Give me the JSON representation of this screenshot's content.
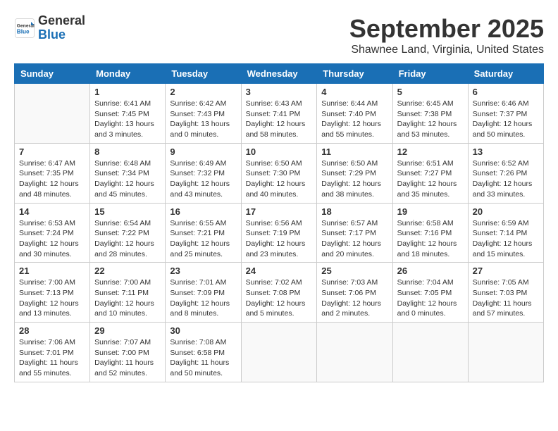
{
  "header": {
    "logo": {
      "general": "General",
      "blue": "Blue"
    },
    "title": "September 2025",
    "location": "Shawnee Land, Virginia, United States"
  },
  "days_of_week": [
    "Sunday",
    "Monday",
    "Tuesday",
    "Wednesday",
    "Thursday",
    "Friday",
    "Saturday"
  ],
  "weeks": [
    [
      {
        "day": "",
        "info": ""
      },
      {
        "day": "1",
        "info": "Sunrise: 6:41 AM\nSunset: 7:45 PM\nDaylight: 13 hours\nand 3 minutes."
      },
      {
        "day": "2",
        "info": "Sunrise: 6:42 AM\nSunset: 7:43 PM\nDaylight: 13 hours\nand 0 minutes."
      },
      {
        "day": "3",
        "info": "Sunrise: 6:43 AM\nSunset: 7:41 PM\nDaylight: 12 hours\nand 58 minutes."
      },
      {
        "day": "4",
        "info": "Sunrise: 6:44 AM\nSunset: 7:40 PM\nDaylight: 12 hours\nand 55 minutes."
      },
      {
        "day": "5",
        "info": "Sunrise: 6:45 AM\nSunset: 7:38 PM\nDaylight: 12 hours\nand 53 minutes."
      },
      {
        "day": "6",
        "info": "Sunrise: 6:46 AM\nSunset: 7:37 PM\nDaylight: 12 hours\nand 50 minutes."
      }
    ],
    [
      {
        "day": "7",
        "info": "Sunrise: 6:47 AM\nSunset: 7:35 PM\nDaylight: 12 hours\nand 48 minutes."
      },
      {
        "day": "8",
        "info": "Sunrise: 6:48 AM\nSunset: 7:34 PM\nDaylight: 12 hours\nand 45 minutes."
      },
      {
        "day": "9",
        "info": "Sunrise: 6:49 AM\nSunset: 7:32 PM\nDaylight: 12 hours\nand 43 minutes."
      },
      {
        "day": "10",
        "info": "Sunrise: 6:50 AM\nSunset: 7:30 PM\nDaylight: 12 hours\nand 40 minutes."
      },
      {
        "day": "11",
        "info": "Sunrise: 6:50 AM\nSunset: 7:29 PM\nDaylight: 12 hours\nand 38 minutes."
      },
      {
        "day": "12",
        "info": "Sunrise: 6:51 AM\nSunset: 7:27 PM\nDaylight: 12 hours\nand 35 minutes."
      },
      {
        "day": "13",
        "info": "Sunrise: 6:52 AM\nSunset: 7:26 PM\nDaylight: 12 hours\nand 33 minutes."
      }
    ],
    [
      {
        "day": "14",
        "info": "Sunrise: 6:53 AM\nSunset: 7:24 PM\nDaylight: 12 hours\nand 30 minutes."
      },
      {
        "day": "15",
        "info": "Sunrise: 6:54 AM\nSunset: 7:22 PM\nDaylight: 12 hours\nand 28 minutes."
      },
      {
        "day": "16",
        "info": "Sunrise: 6:55 AM\nSunset: 7:21 PM\nDaylight: 12 hours\nand 25 minutes."
      },
      {
        "day": "17",
        "info": "Sunrise: 6:56 AM\nSunset: 7:19 PM\nDaylight: 12 hours\nand 23 minutes."
      },
      {
        "day": "18",
        "info": "Sunrise: 6:57 AM\nSunset: 7:17 PM\nDaylight: 12 hours\nand 20 minutes."
      },
      {
        "day": "19",
        "info": "Sunrise: 6:58 AM\nSunset: 7:16 PM\nDaylight: 12 hours\nand 18 minutes."
      },
      {
        "day": "20",
        "info": "Sunrise: 6:59 AM\nSunset: 7:14 PM\nDaylight: 12 hours\nand 15 minutes."
      }
    ],
    [
      {
        "day": "21",
        "info": "Sunrise: 7:00 AM\nSunset: 7:13 PM\nDaylight: 12 hours\nand 13 minutes."
      },
      {
        "day": "22",
        "info": "Sunrise: 7:00 AM\nSunset: 7:11 PM\nDaylight: 12 hours\nand 10 minutes."
      },
      {
        "day": "23",
        "info": "Sunrise: 7:01 AM\nSunset: 7:09 PM\nDaylight: 12 hours\nand 8 minutes."
      },
      {
        "day": "24",
        "info": "Sunrise: 7:02 AM\nSunset: 7:08 PM\nDaylight: 12 hours\nand 5 minutes."
      },
      {
        "day": "25",
        "info": "Sunrise: 7:03 AM\nSunset: 7:06 PM\nDaylight: 12 hours\nand 2 minutes."
      },
      {
        "day": "26",
        "info": "Sunrise: 7:04 AM\nSunset: 7:05 PM\nDaylight: 12 hours\nand 0 minutes."
      },
      {
        "day": "27",
        "info": "Sunrise: 7:05 AM\nSunset: 7:03 PM\nDaylight: 11 hours\nand 57 minutes."
      }
    ],
    [
      {
        "day": "28",
        "info": "Sunrise: 7:06 AM\nSunset: 7:01 PM\nDaylight: 11 hours\nand 55 minutes."
      },
      {
        "day": "29",
        "info": "Sunrise: 7:07 AM\nSunset: 7:00 PM\nDaylight: 11 hours\nand 52 minutes."
      },
      {
        "day": "30",
        "info": "Sunrise: 7:08 AM\nSunset: 6:58 PM\nDaylight: 11 hours\nand 50 minutes."
      },
      {
        "day": "",
        "info": ""
      },
      {
        "day": "",
        "info": ""
      },
      {
        "day": "",
        "info": ""
      },
      {
        "day": "",
        "info": ""
      }
    ]
  ]
}
